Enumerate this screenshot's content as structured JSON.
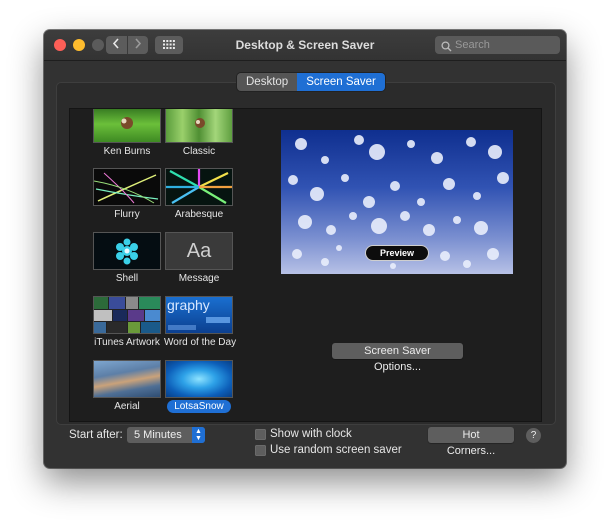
{
  "window": {
    "title": "Desktop & Screen Saver",
    "search_placeholder": "Search"
  },
  "icons": {
    "back": "chevron-left-icon",
    "forward": "chevron-right-icon",
    "show_all": "grid-icon",
    "search": "search-icon"
  },
  "tabs": [
    {
      "label": "Desktop",
      "active": false
    },
    {
      "label": "Screen Saver",
      "active": true
    }
  ],
  "savers": [
    {
      "label": "Ken Burns"
    },
    {
      "label": "Classic"
    },
    {
      "label": "Flurry"
    },
    {
      "label": "Arabesque"
    },
    {
      "label": "Shell"
    },
    {
      "label": "Message",
      "thumb_text": "Aa"
    },
    {
      "label": "iTunes Artwork"
    },
    {
      "label": "Word of the Day",
      "thumb_text": "graphy"
    },
    {
      "label": "Aerial"
    },
    {
      "label": "LotsaSnow",
      "selected": true
    }
  ],
  "preview": {
    "button_label": "Preview"
  },
  "options_button": "Screen Saver Options...",
  "start_after": {
    "label": "Start after:",
    "value": "5 Minutes"
  },
  "checkboxes": {
    "show_clock": {
      "label": "Show with clock",
      "checked": false
    },
    "random": {
      "label": "Use random screen saver",
      "checked": false
    }
  },
  "hot_corners_button": "Hot Corners...",
  "help_button": "?",
  "colors": {
    "accent": "#1f6fd4",
    "window_bg": "#323232",
    "close": "#fd5f57",
    "minimize": "#febc2e"
  }
}
